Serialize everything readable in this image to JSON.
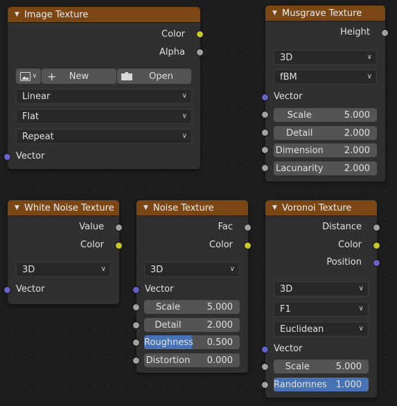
{
  "nodes": {
    "image_texture": {
      "title": "Image Texture",
      "outputs": [
        "Color",
        "Alpha"
      ],
      "new_label": "New",
      "open_label": "Open",
      "interpolation": "Linear",
      "projection": "Flat",
      "extension": "Repeat",
      "input_vector": "Vector"
    },
    "musgrave_texture": {
      "title": "Musgrave Texture",
      "output": "Height",
      "dimensions": "3D",
      "type": "fBM",
      "input_vector": "Vector",
      "fields": [
        {
          "label": "Scale",
          "value": "5.000"
        },
        {
          "label": "Detail",
          "value": "2.000"
        },
        {
          "label": "Dimension",
          "value": "2.000"
        },
        {
          "label": "Lacunarity",
          "value": "2.000"
        }
      ]
    },
    "white_noise_texture": {
      "title": "White Noise Texture",
      "outputs": [
        "Value",
        "Color"
      ],
      "dimensions": "3D",
      "input_vector": "Vector"
    },
    "noise_texture": {
      "title": "Noise Texture",
      "outputs": [
        "Fac",
        "Color"
      ],
      "dimensions": "3D",
      "input_vector": "Vector",
      "fields": [
        {
          "label": "Scale",
          "value": "5.000"
        },
        {
          "label": "Detail",
          "value": "2.000"
        },
        {
          "label": "Roughness",
          "value": "0.500",
          "fill": 0.5
        },
        {
          "label": "Distortion",
          "value": "0.000"
        }
      ]
    },
    "voronoi_texture": {
      "title": "Voronoi Texture",
      "outputs": [
        "Distance",
        "Color",
        "Position"
      ],
      "dimensions": "3D",
      "feature": "F1",
      "distance": "Euclidean",
      "input_vector": "Vector",
      "fields": [
        {
          "label": "Scale",
          "value": "5.000"
        },
        {
          "label": "Randomnes",
          "value": "1.000",
          "fill": 1.0
        }
      ]
    }
  },
  "colors": {
    "header": "#7a4614",
    "socket_color": "#c7c729",
    "socket_float": "#a1a1a1",
    "socket_vector": "#6363c7",
    "slider_fill": "#4772b3"
  }
}
